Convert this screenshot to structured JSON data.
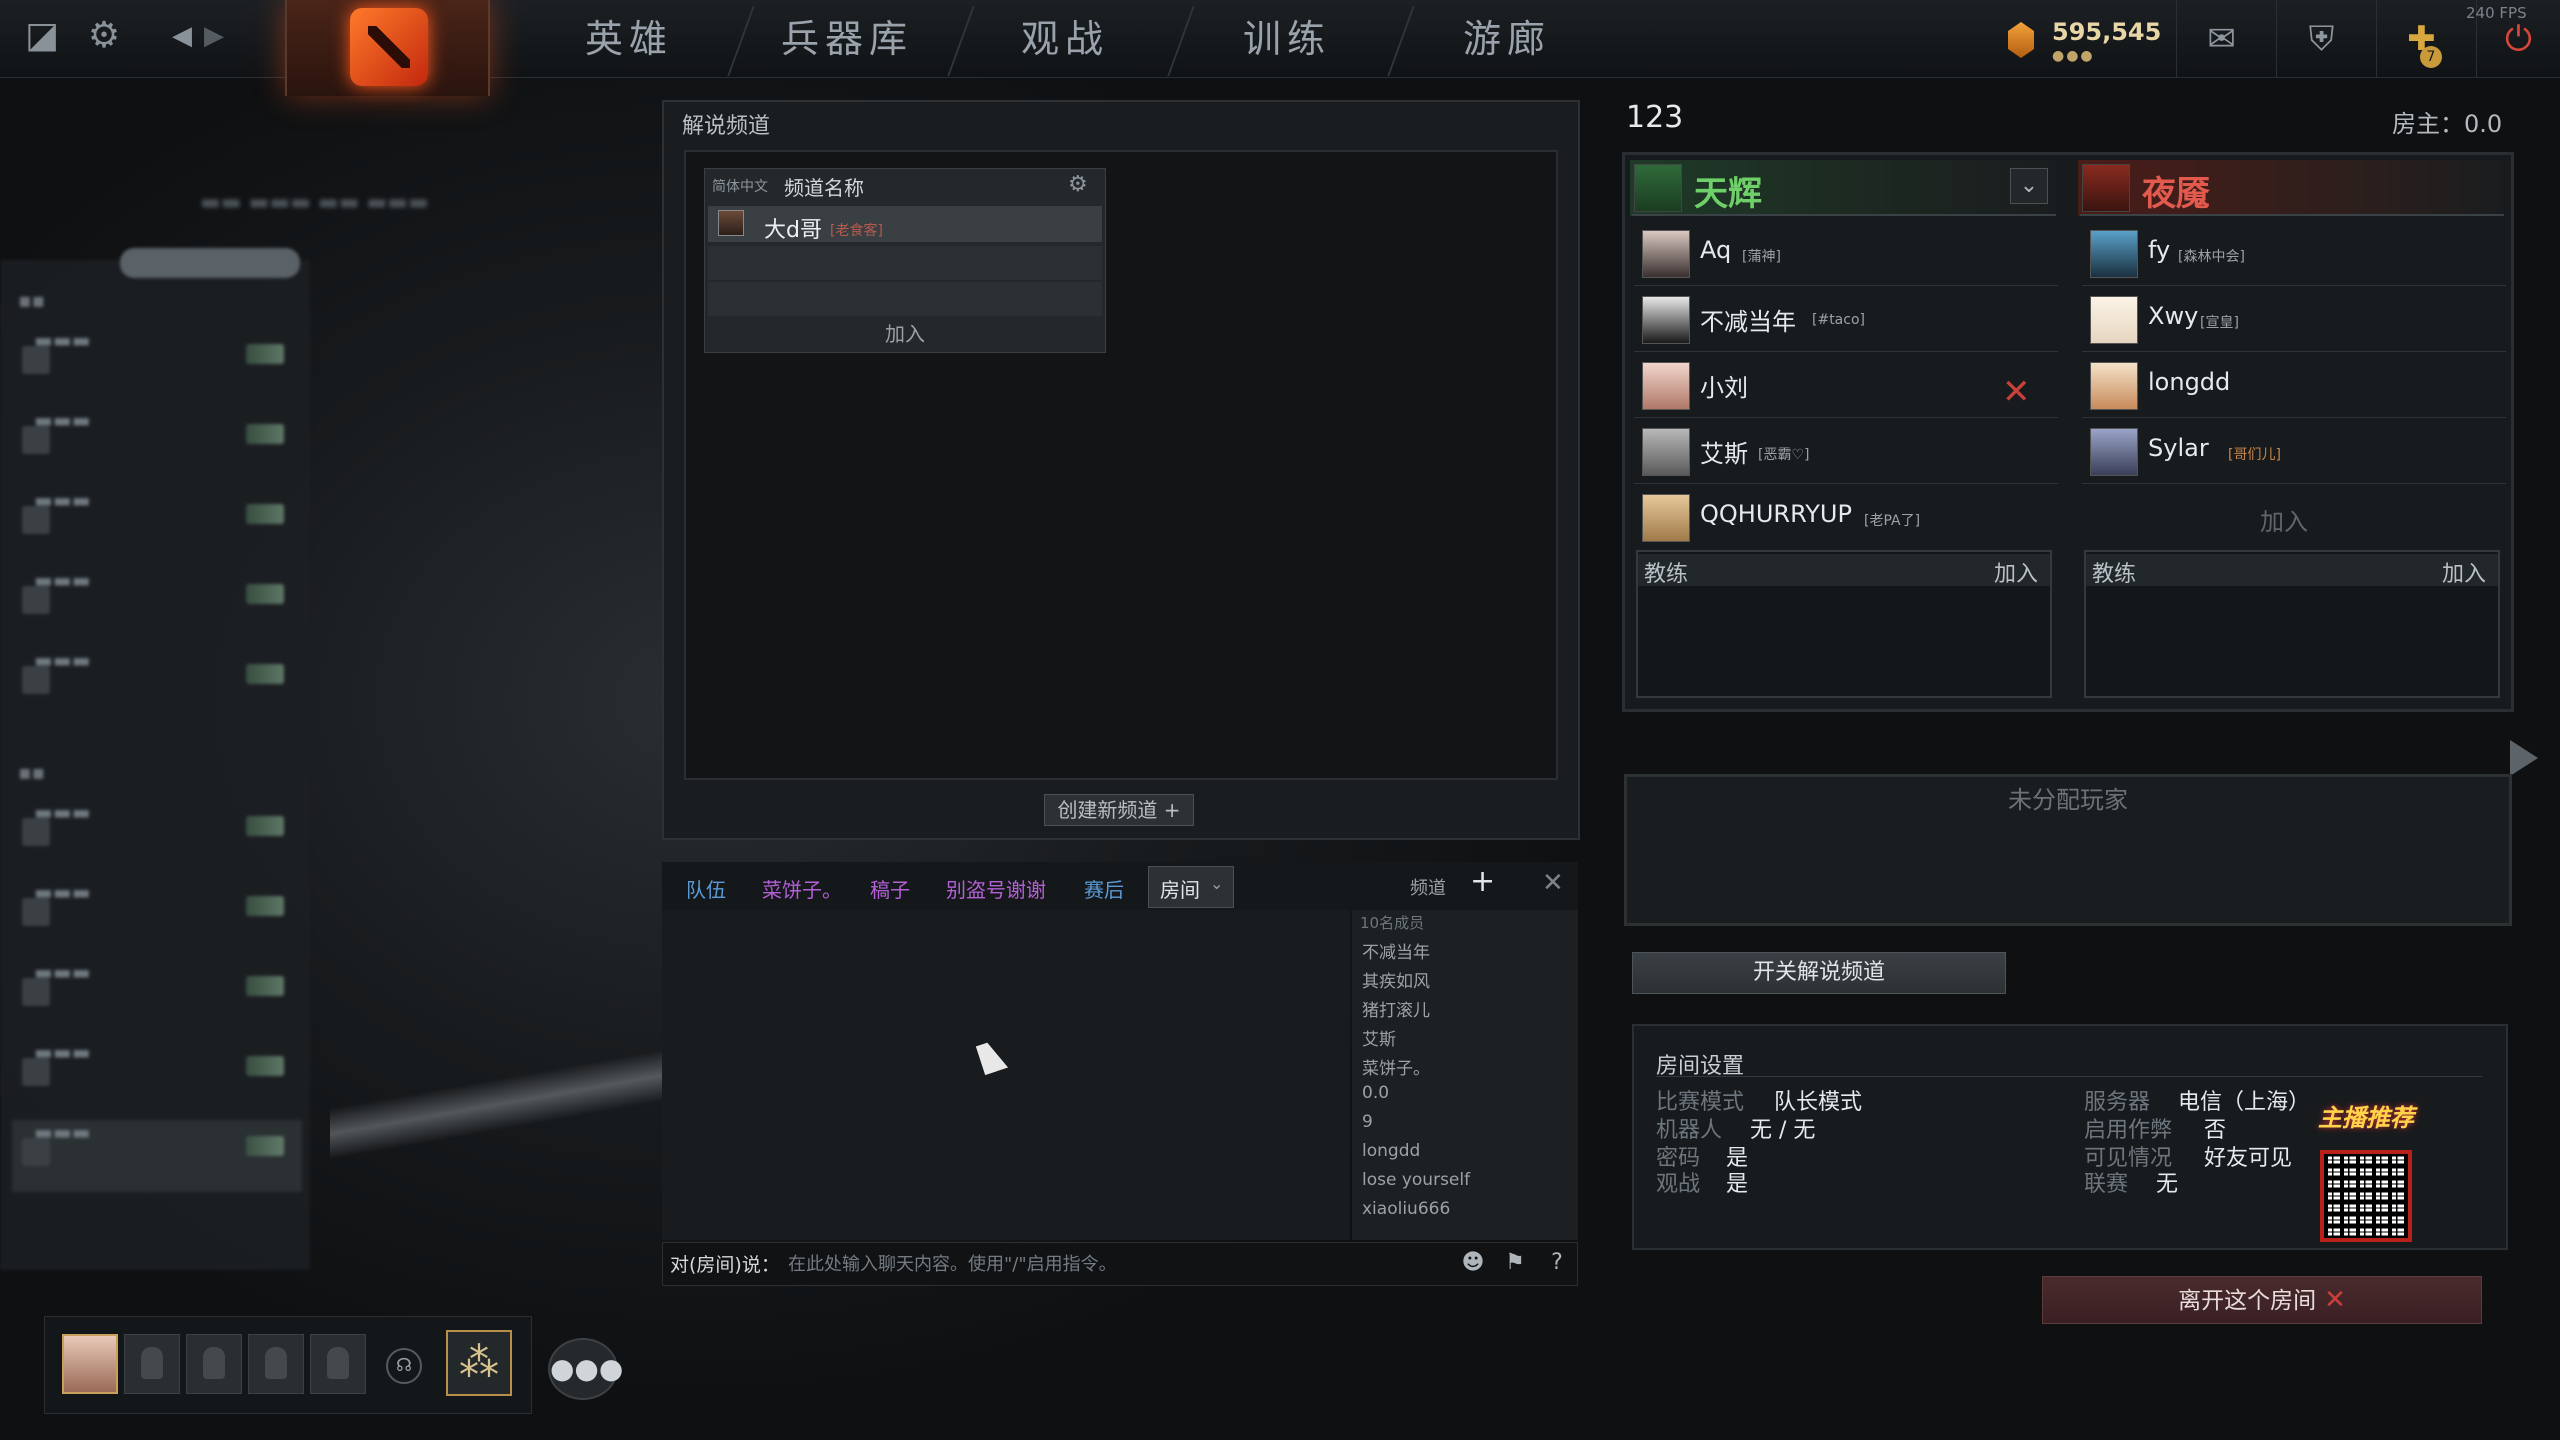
{
  "topbar": {
    "nav": [
      "英雄",
      "兵器库",
      "观战",
      "训练",
      "游廊"
    ],
    "gold": "595,545",
    "fps": "240 FPS",
    "badge_count": "7"
  },
  "caster": {
    "title": "解说频道",
    "header_lang": "简体中文",
    "header_name": "频道名称",
    "channel_name": "大d哥",
    "channel_tag": "[老食客]",
    "join": "加入",
    "create": "创建新频道 +"
  },
  "chat": {
    "tabs": [
      "队伍",
      "菜饼子。",
      "稿子",
      "别盗号谢谢",
      "赛后"
    ],
    "active_tab": "房间",
    "channel_label": "频道",
    "member_count": "10名成员",
    "members": [
      "不减当年",
      "其疾如风",
      "猪打滚儿",
      "艾斯",
      "菜饼子。",
      "0.0",
      "9",
      "longdd",
      "lose yourself",
      "xiaoliu666"
    ],
    "prefix": "对(房间)说：",
    "placeholder": "在此处输入聊天内容。使用\"/\"启用指令。"
  },
  "lobby": {
    "name": "123",
    "host": "房主：0.0",
    "radiant": {
      "name": "天辉",
      "players": [
        {
          "name": "Aq",
          "tag": "[蒲神]"
        },
        {
          "name": "不减当年",
          "tag": "[#taco]"
        },
        {
          "name": "小刘",
          "tag": ""
        },
        {
          "name": "艾斯",
          "tag": "[恶霸♡]"
        },
        {
          "name": "QQHURRYUP",
          "tag": "[老PA了]"
        }
      ]
    },
    "dire": {
      "name": "夜魇",
      "players": [
        {
          "name": "fy",
          "tag": "[森林中会]"
        },
        {
          "name": "Xwy",
          "tag": "[宣皇]"
        },
        {
          "name": "longdd",
          "tag": ""
        },
        {
          "name": "Sylar",
          "tag": "[哥们儿]"
        }
      ],
      "join": "加入"
    },
    "coach_label": "教练",
    "coach_join": "加入",
    "unassigned": "未分配玩家",
    "caster_toggle": "开关解说频道",
    "leave": "离开这个房间"
  },
  "settings": {
    "title": "房间设置",
    "left": [
      {
        "k": "比赛模式",
        "v": "队长模式"
      },
      {
        "k": "机器人",
        "v": "无 / 无"
      },
      {
        "k": "密码",
        "v": "是"
      },
      {
        "k": "观战",
        "v": "是"
      }
    ],
    "right": [
      {
        "k": "服务器",
        "v": "电信（上海）"
      },
      {
        "k": "启用作弊",
        "v": "否"
      },
      {
        "k": "可见情况",
        "v": "好友可见"
      },
      {
        "k": "联赛",
        "v": "无"
      }
    ],
    "qr_title": "主播推荐"
  },
  "colors": {
    "radiant": "#6fd06a",
    "dire": "#e2594e",
    "chat_tab": "#b35fd6",
    "chat_tab_blue": "#5a9ad6"
  }
}
